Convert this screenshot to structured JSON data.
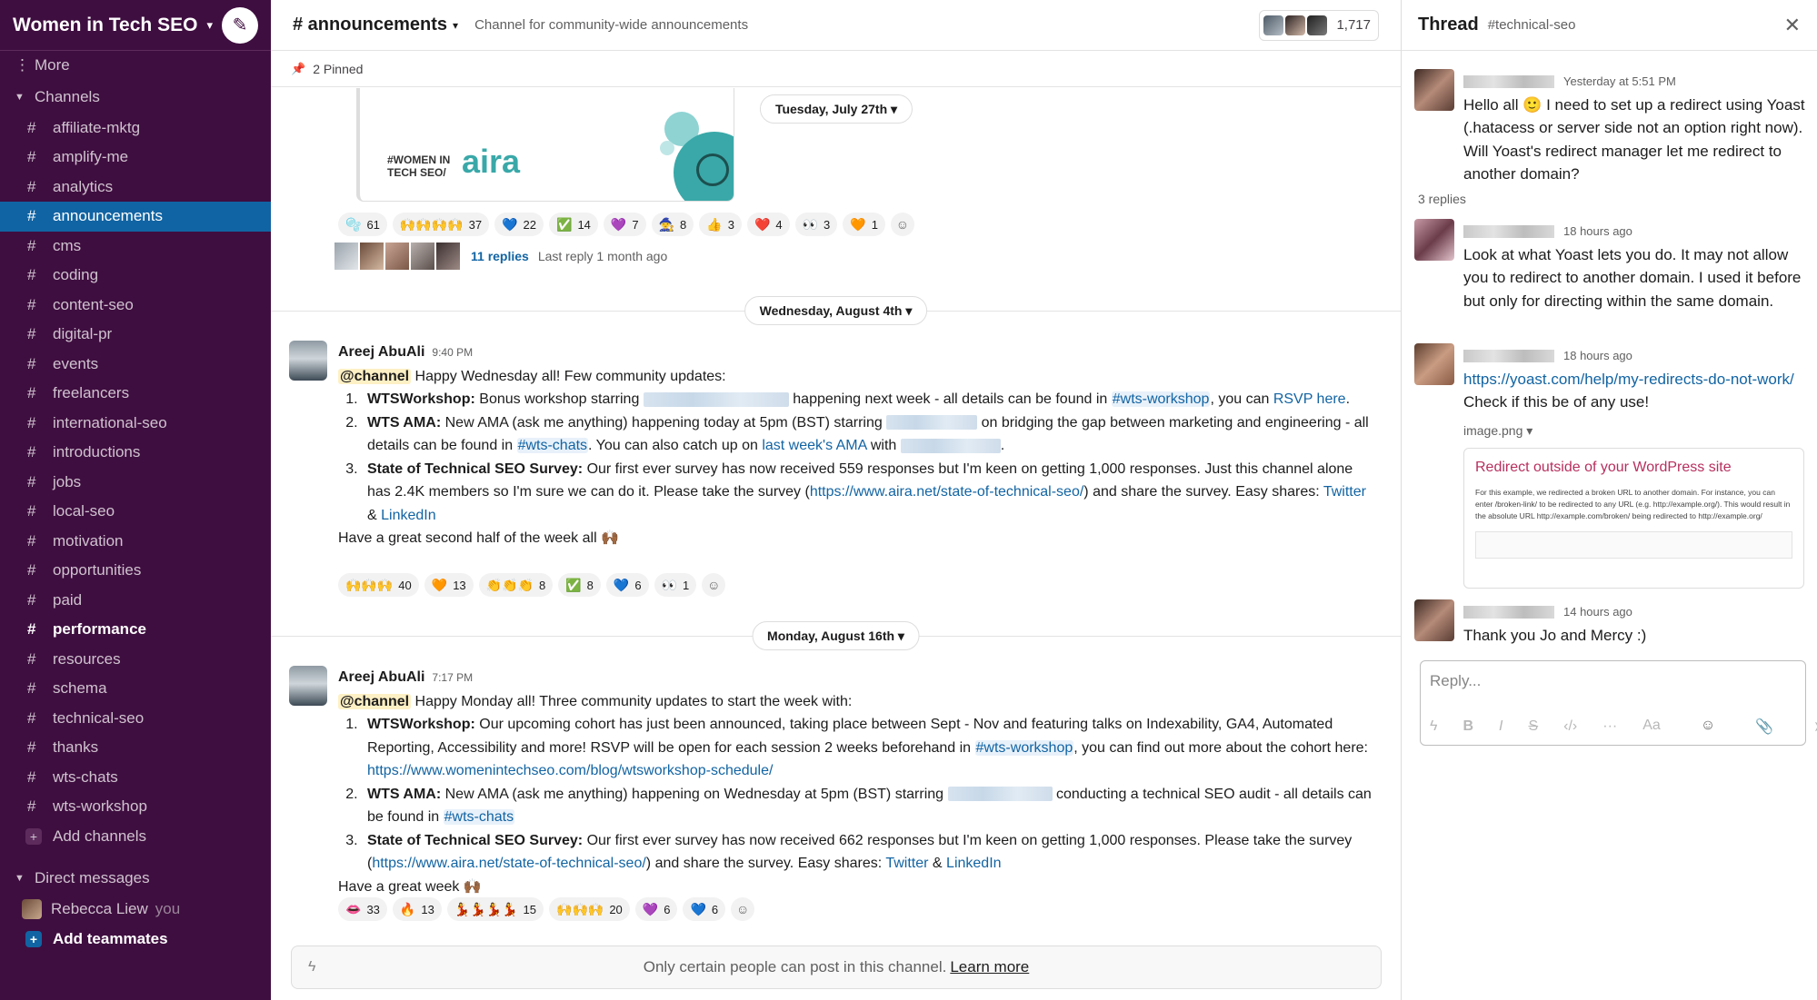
{
  "workspace": {
    "name": "Women in Tech SEO"
  },
  "sidebar": {
    "more": "More",
    "channels_label": "Channels",
    "channels": [
      "affiliate-mktg",
      "amplify-me",
      "analytics",
      "announcements",
      "cms",
      "coding",
      "content-seo",
      "digital-pr",
      "events",
      "freelancers",
      "international-seo",
      "introductions",
      "jobs",
      "local-seo",
      "motivation",
      "opportunities",
      "paid",
      "performance",
      "resources",
      "schema",
      "technical-seo",
      "thanks",
      "wts-chats",
      "wts-workshop"
    ],
    "active_channel": "announcements",
    "bold_channel": "performance",
    "add_channels": "Add channels",
    "dm_label": "Direct messages",
    "dm_user": "Rebecca Liew",
    "dm_you": "you",
    "add_teammates": "Add teammates"
  },
  "channel": {
    "name": "# announcements",
    "topic": "Channel for community-wide announcements",
    "member_count": "1,717",
    "pinned": "2 Pinned"
  },
  "attachment": {
    "brand_text_1": "#WOMEN IN",
    "brand_text_2": "TECH SEO/",
    "brand_logo": "aira"
  },
  "dates": {
    "d1": "Tuesday, July 27th",
    "d2": "Wednesday, August 4th",
    "d3": "Monday, August 16th"
  },
  "reactions1": [
    {
      "e": "🫧",
      "c": "61"
    },
    {
      "e": "🙌🙌🙌🙌",
      "c": "37"
    },
    {
      "e": "💙",
      "c": "22"
    },
    {
      "e": "✅",
      "c": "14"
    },
    {
      "e": "💜",
      "c": "7"
    },
    {
      "e": "🧙",
      "c": "8"
    },
    {
      "e": "👍",
      "c": "3"
    },
    {
      "e": "❤️",
      "c": "4"
    },
    {
      "e": "👀",
      "c": "3"
    },
    {
      "e": "🧡",
      "c": "1"
    }
  ],
  "thread_summary": {
    "replies": "11 replies",
    "last": "Last reply 1 month ago"
  },
  "msg1": {
    "author": "Areej AbuAli",
    "time": "9:40 PM",
    "mention": "@channel",
    "intro": "Happy Wednesday all! Few community updates:",
    "i1_bold": "WTSWorkshop:",
    "i1_a": "Bonus workshop starring",
    "i1_b": "happening next week - all details can be found in",
    "i1_ch": "#wts-workshop",
    "i1_c": ", you can",
    "i1_link": "RSVP here",
    "i1_d": ".",
    "i2_bold": "WTS AMA:",
    "i2_a": "New AMA (ask me anything) happening today at 5pm (BST) starring",
    "i2_b": "on bridging the gap between marketing and engineering - all details can be found in",
    "i2_ch": "#wts-chats",
    "i2_c": ". You can also catch up on",
    "i2_link": "last week's AMA",
    "i2_d": "with",
    "i2_e": ".",
    "i3_bold": "State of Technical SEO Survey:",
    "i3_a": "Our first ever survey has now received 559 responses but I'm keen on getting 1,000 responses. Just this channel alone has 2.4K members so I'm sure we can do it. Please take the survey (",
    "i3_url": "https://www.aira.net/state-of-technical-seo/",
    "i3_b": ") and share the survey. Easy shares:",
    "i3_tw": "Twitter",
    "i3_amp": "&",
    "i3_li": "LinkedIn",
    "outro": "Have a great second half of the week all 🙌🏾"
  },
  "reactions2": [
    {
      "e": "🙌🙌🙌",
      "c": "40"
    },
    {
      "e": "🧡",
      "c": "13"
    },
    {
      "e": "👏👏👏",
      "c": "8"
    },
    {
      "e": "✅",
      "c": "8"
    },
    {
      "e": "💙",
      "c": "6"
    },
    {
      "e": "👀",
      "c": "1"
    }
  ],
  "msg2": {
    "author": "Areej AbuAli",
    "time": "7:17 PM",
    "mention": "@channel",
    "intro": "Happy Monday all! Three community updates to start the week with:",
    "i1_bold": "WTSWorkshop:",
    "i1_a": "Our upcoming cohort has just been announced, taking place between Sept - Nov and featuring talks on Indexability, GA4, Automated Reporting, Accessibility and more! RSVP will be open for each session 2 weeks beforehand in",
    "i1_ch": "#wts-workshop",
    "i1_b": ", you can find out more about the cohort here:",
    "i1_url": "https://www.womenintechseo.com/blog/wtsworkshop-schedule/",
    "i2_bold": "WTS AMA:",
    "i2_a": "New AMA (ask me anything) happening on Wednesday at 5pm (BST) starring",
    "i2_b": "conducting a technical SEO audit - all details can be found in",
    "i2_ch": "#wts-chats",
    "i3_bold": "State of Technical SEO Survey:",
    "i3_a": "Our first ever survey has now received 662 responses but I'm keen on getting 1,000 responses. Please take the survey (",
    "i3_url": "https://www.aira.net/state-of-technical-seo/",
    "i3_b": ") and share the survey. Easy shares:",
    "i3_tw": "Twitter",
    "i3_amp": "&",
    "i3_li": "LinkedIn",
    "outro": "Have a great week 🙌🏾"
  },
  "reactions3": [
    {
      "e": "👄",
      "c": "33"
    },
    {
      "e": "🔥",
      "c": "13"
    },
    {
      "e": "💃💃💃💃",
      "c": "15"
    },
    {
      "e": "🙌🙌🙌",
      "c": "20"
    },
    {
      "e": "💜",
      "c": "6"
    },
    {
      "e": "💙",
      "c": "6"
    }
  ],
  "composer": {
    "text": "Only certain people can post in this channel.",
    "learn": "Learn more"
  },
  "thread": {
    "title": "Thread",
    "channel": "#technical-seo",
    "m1_time": "Yesterday at 5:51 PM",
    "m1_text": "Hello all 🙂 I need to set up a redirect using Yoast (.hatacess or server side not an option right now). Will Yoast's redirect manager let me redirect to another domain?",
    "replies": "3 replies",
    "m2_time": "18 hours ago",
    "m2_text": "Look at what Yoast lets you do. It may not allow you to redirect to another domain. I used it before but only for directing within the same domain.",
    "m3_time": "18 hours ago",
    "m3_url": "https://yoast.com/help/my-redirects-do-not-work/",
    "m3_text": "Check if this be of any use!",
    "m3_image": "image.png ▾",
    "preview_title": "Redirect outside of your WordPress site",
    "preview_text": "For this example, we redirected a broken URL to another domain. For instance, you can enter /broken-link/ to be redirected to any URL (e.g. http://example.org/). This would result in the absolute URL http://example.com/broken/ being redirected to http://example.org/",
    "m4_time": "14 hours ago",
    "m4_text": "Thank you Jo and Mercy :)",
    "reply_placeholder": "Reply..."
  }
}
